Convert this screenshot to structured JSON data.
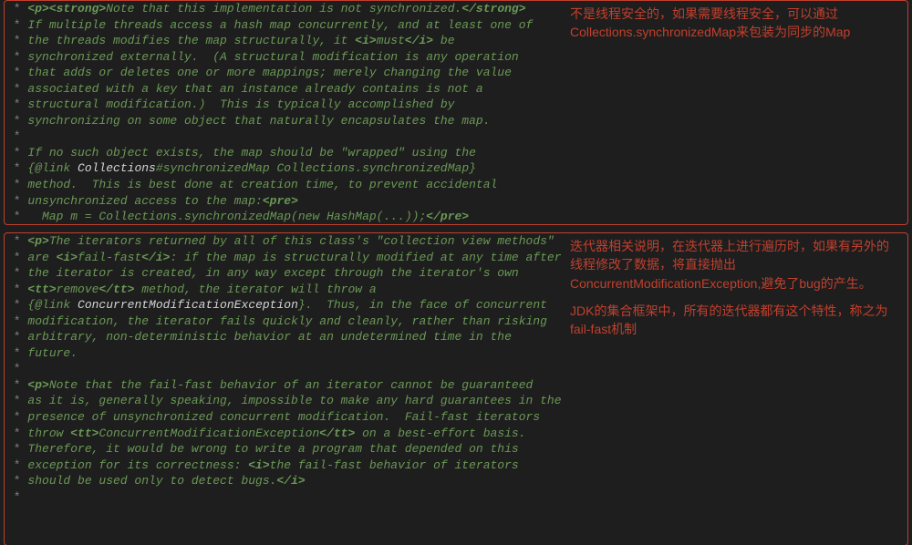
{
  "box1": {
    "code": [
      {
        "star": "*",
        "segs": [
          {
            "c": "jd",
            "t": " "
          },
          {
            "c": "tag",
            "t": "<p><strong>"
          },
          {
            "c": "jd",
            "t": "Note that this implementation is not synchronized."
          },
          {
            "c": "tag",
            "t": "</strong>"
          }
        ]
      },
      {
        "star": "*",
        "segs": [
          {
            "c": "jd",
            "t": " If multiple threads access a hash map concurrently, and at least one of"
          }
        ]
      },
      {
        "star": "*",
        "segs": [
          {
            "c": "jd",
            "t": " the threads modifies the map structurally, it "
          },
          {
            "c": "tag",
            "t": "<i>"
          },
          {
            "c": "jd",
            "t": "must"
          },
          {
            "c": "tag",
            "t": "</i>"
          },
          {
            "c": "jd",
            "t": " be"
          }
        ]
      },
      {
        "star": "*",
        "segs": [
          {
            "c": "jd",
            "t": " synchronized externally.  (A structural modification is any operation"
          }
        ]
      },
      {
        "star": "*",
        "segs": [
          {
            "c": "jd",
            "t": " that adds or deletes one or more mappings; merely changing the value"
          }
        ]
      },
      {
        "star": "*",
        "segs": [
          {
            "c": "jd",
            "t": " associated with a key that an instance already contains is not a"
          }
        ]
      },
      {
        "star": "*",
        "segs": [
          {
            "c": "jd",
            "t": " structural modification.)  This is typically accomplished by"
          }
        ]
      },
      {
        "star": "*",
        "segs": [
          {
            "c": "jd",
            "t": " synchronizing on some object that naturally encapsulates the map."
          }
        ]
      },
      {
        "star": "*",
        "segs": []
      },
      {
        "star": "*",
        "segs": [
          {
            "c": "jd",
            "t": " If no such object exists, the map should be \"wrapped\" using the"
          }
        ]
      },
      {
        "star": "*",
        "segs": [
          {
            "c": "jd",
            "t": " "
          },
          {
            "c": "lnk",
            "t": "{@link "
          },
          {
            "c": "cls",
            "t": "Collections"
          },
          {
            "c": "lnk",
            "t": "#synchronizedMap Collections.synchronizedMap}"
          }
        ]
      },
      {
        "star": "*",
        "segs": [
          {
            "c": "jd",
            "t": " method.  This is best done at creation time, to prevent accidental"
          }
        ]
      },
      {
        "star": "*",
        "segs": [
          {
            "c": "jd",
            "t": " unsynchronized access to the map:"
          },
          {
            "c": "tag",
            "t": "<pre>"
          }
        ]
      },
      {
        "star": "*",
        "segs": [
          {
            "c": "jd",
            "t": "   Map m = Collections.synchronizedMap(new HashMap(...));"
          },
          {
            "c": "tag",
            "t": "</pre>"
          }
        ]
      }
    ],
    "note": "不是线程安全的，如果需要线程安全，可以通过Collections.synchronizedMap来包装为同步的Map"
  },
  "box2": {
    "code": [
      {
        "star": "*",
        "segs": [
          {
            "c": "jd",
            "t": " "
          },
          {
            "c": "tag",
            "t": "<p>"
          },
          {
            "c": "jd",
            "t": "The iterators returned by all of this class's \"collection view methods\""
          }
        ]
      },
      {
        "star": "*",
        "segs": [
          {
            "c": "jd",
            "t": " are "
          },
          {
            "c": "tag",
            "t": "<i>"
          },
          {
            "c": "jd",
            "t": "fail-fast"
          },
          {
            "c": "tag",
            "t": "</i>"
          },
          {
            "c": "jd",
            "t": ": if the map is structurally modified at any time after"
          }
        ]
      },
      {
        "star": "*",
        "segs": [
          {
            "c": "jd",
            "t": " the iterator is created, in any way except through the iterator's own"
          }
        ]
      },
      {
        "star": "*",
        "segs": [
          {
            "c": "jd",
            "t": " "
          },
          {
            "c": "tag",
            "t": "<tt>"
          },
          {
            "c": "jd",
            "t": "remove"
          },
          {
            "c": "tag",
            "t": "</tt>"
          },
          {
            "c": "jd",
            "t": " method, the iterator will throw a"
          }
        ]
      },
      {
        "star": "*",
        "segs": [
          {
            "c": "jd",
            "t": " "
          },
          {
            "c": "lnk",
            "t": "{@link "
          },
          {
            "c": "cls",
            "t": "ConcurrentModificationException"
          },
          {
            "c": "lnk",
            "t": "}"
          },
          {
            "c": "jd",
            "t": ".  Thus, in the face of concurrent"
          }
        ]
      },
      {
        "star": "*",
        "segs": [
          {
            "c": "jd",
            "t": " modification, the iterator fails quickly and cleanly, rather than risking"
          }
        ]
      },
      {
        "star": "*",
        "segs": [
          {
            "c": "jd",
            "t": " arbitrary, non-deterministic behavior at an undetermined time in the"
          }
        ]
      },
      {
        "star": "*",
        "segs": [
          {
            "c": "jd",
            "t": " future."
          }
        ]
      },
      {
        "star": "*",
        "segs": []
      },
      {
        "star": "*",
        "segs": [
          {
            "c": "jd",
            "t": " "
          },
          {
            "c": "tag",
            "t": "<p>"
          },
          {
            "c": "jd",
            "t": "Note that the fail-fast behavior of an iterator cannot be guaranteed"
          }
        ]
      },
      {
        "star": "*",
        "segs": [
          {
            "c": "jd",
            "t": " as it is, generally speaking, impossible to make any hard guarantees in the"
          }
        ]
      },
      {
        "star": "*",
        "segs": [
          {
            "c": "jd",
            "t": " presence of unsynchronized concurrent modification.  Fail-fast iterators"
          }
        ]
      },
      {
        "star": "*",
        "segs": [
          {
            "c": "jd",
            "t": " throw "
          },
          {
            "c": "tag",
            "t": "<tt>"
          },
          {
            "c": "jd",
            "t": "ConcurrentModificationException"
          },
          {
            "c": "tag",
            "t": "</tt>"
          },
          {
            "c": "jd",
            "t": " on a best-effort basis."
          }
        ]
      },
      {
        "star": "*",
        "segs": [
          {
            "c": "jd",
            "t": " Therefore, it would be wrong to write a program that depended on this"
          }
        ]
      },
      {
        "star": "*",
        "segs": [
          {
            "c": "jd",
            "t": " exception for its correctness: "
          },
          {
            "c": "tag",
            "t": "<i>"
          },
          {
            "c": "jd",
            "t": "the fail-fast behavior of iterators"
          }
        ]
      },
      {
        "star": "*",
        "segs": [
          {
            "c": "jd",
            "t": " should be used only to detect bugs."
          },
          {
            "c": "tag",
            "t": "</i>"
          }
        ]
      },
      {
        "star": "*",
        "segs": []
      }
    ],
    "note1": "迭代器相关说明，在迭代器上进行遍历时，如果有另外的线程修改了数据，将直接抛出ConcurrentModificationException,避免了bug的产生。",
    "note2": "JDK的集合框架中，所有的迭代器都有这个特性，称之为fail-fast机制"
  }
}
